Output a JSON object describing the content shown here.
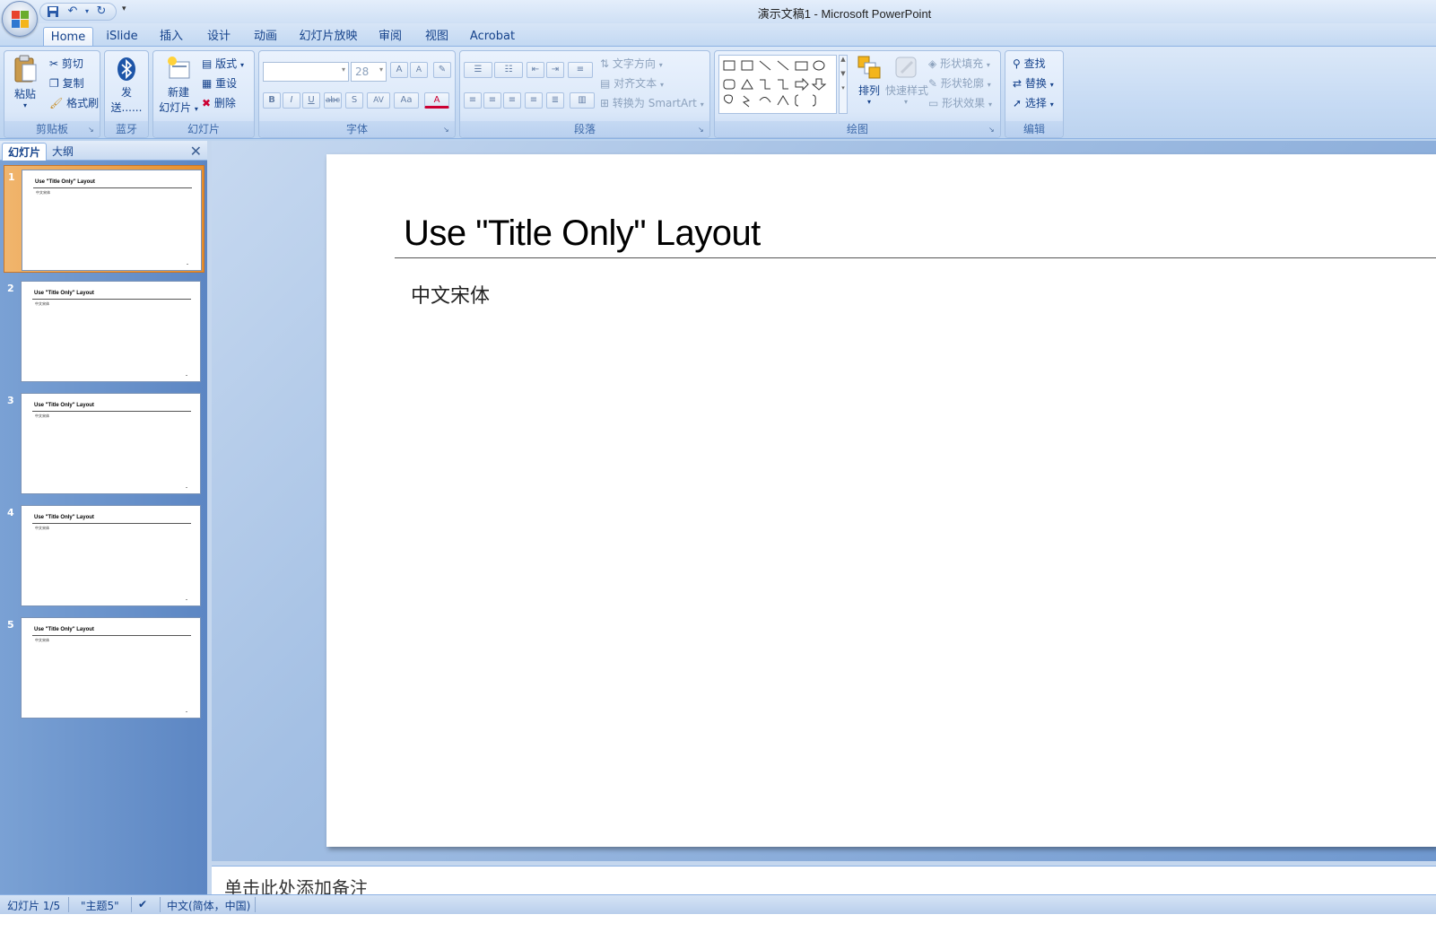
{
  "window": {
    "title": "演示文稿1 - Microsoft PowerPoint"
  },
  "qat": {
    "icons": [
      "save-icon",
      "undo-icon",
      "redo-icon"
    ],
    "more": "▾"
  },
  "tabs": [
    {
      "label": "Home",
      "active": true
    },
    {
      "label": "iSlide"
    },
    {
      "label": "插入"
    },
    {
      "label": "设计"
    },
    {
      "label": "动画"
    },
    {
      "label": "幻灯片放映"
    },
    {
      "label": "审阅"
    },
    {
      "label": "视图"
    },
    {
      "label": "Acrobat"
    }
  ],
  "ribbon": {
    "clipboard": {
      "label": "剪贴板",
      "paste": "粘贴",
      "cut": "剪切",
      "copy": "复制",
      "format_painter": "格式刷"
    },
    "bluetooth": {
      "label": "蓝牙",
      "send_line1": "发",
      "send_line2": "送......"
    },
    "slides": {
      "label": "幻灯片",
      "new_slide_line1": "新建",
      "new_slide_line2": "幻灯片",
      "layout": "版式",
      "reset": "重设",
      "delete": "删除"
    },
    "font": {
      "label": "字体",
      "font_name": "",
      "font_size": "28",
      "grow": "A",
      "shrink": "A",
      "bold": "B",
      "italic": "I",
      "underline": "U",
      "strike": "abc",
      "shadow": "S",
      "spacing": "AV",
      "case": "Aa",
      "color": "A"
    },
    "paragraph": {
      "label": "段落",
      "text_direction": "文字方向",
      "align_text": "对齐文本",
      "convert_smartart": "转换为 SmartArt"
    },
    "drawing": {
      "label": "绘图",
      "arrange": "排列",
      "quick_styles": "快速样式",
      "shape_fill": "形状填充",
      "shape_outline": "形状轮廓",
      "shape_effects": "形状效果"
    },
    "editing": {
      "label": "编辑",
      "find": "查找",
      "replace": "替换",
      "select": "选择"
    }
  },
  "panel": {
    "tab_slides": "幻灯片",
    "tab_outline": "大纲",
    "close": "✕",
    "thumbnails": [
      {
        "num": "1",
        "title": "Use \"Title Only\" Layout",
        "sub": "中文宋体",
        "selected": true
      },
      {
        "num": "2",
        "title": "Use \"Title Only\" Layout",
        "sub": "中文宋体"
      },
      {
        "num": "3",
        "title": "Use \"Title Only\" Layout",
        "sub": "中文宋体"
      },
      {
        "num": "4",
        "title": "Use \"Title Only\" Layout",
        "sub": "中文宋体"
      },
      {
        "num": "5",
        "title": "Use \"Title Only\" Layout",
        "sub": "中文宋体"
      }
    ]
  },
  "slide": {
    "title": "Use \"Title Only\" Layout",
    "body": "中文宋体"
  },
  "notes": {
    "placeholder": "单击此处添加备注"
  },
  "status": {
    "slide": "幻灯片 1/5",
    "theme": "\"主题5\"",
    "language": "中文(简体，中国)"
  }
}
